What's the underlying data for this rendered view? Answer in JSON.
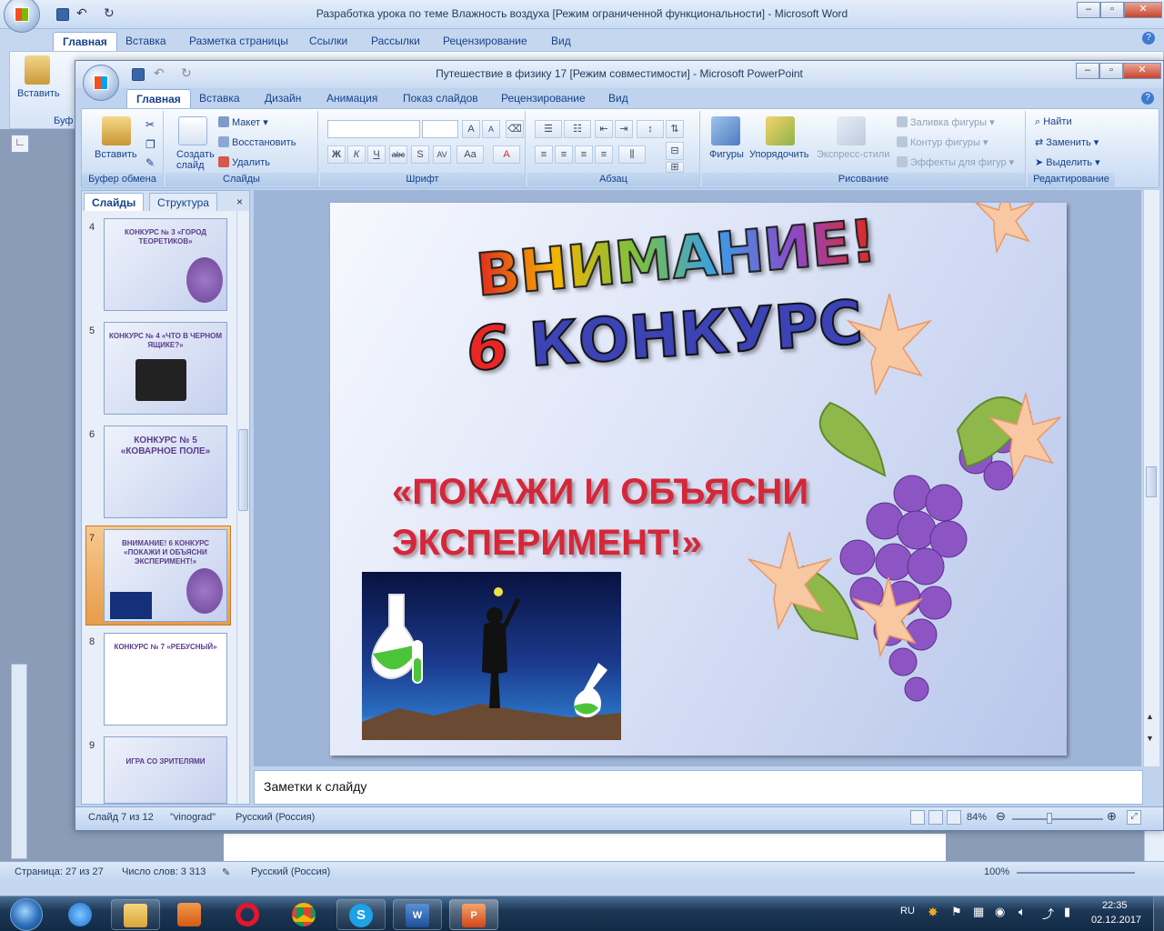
{
  "word": {
    "title": "Разработка урока по теме Влажность воздуха [Режим ограниченной функциональности] - Microsoft Word",
    "tabs": [
      "Главная",
      "Вставка",
      "Разметка страницы",
      "Ссылки",
      "Рассылки",
      "Рецензирование",
      "Вид"
    ],
    "paste_label": "Вставить",
    "clipboard_label": "Буф",
    "status": {
      "page": "Страница: 27 из 27",
      "words": "Число слов: 3 313",
      "lang": "Русский (Россия)",
      "zoom": "100%"
    }
  },
  "ppt": {
    "title": "Путешествие  в физику 17 [Режим совместимости] - Microsoft PowerPoint",
    "tabs": [
      "Главная",
      "Вставка",
      "Дизайн",
      "Анимация",
      "Показ слайдов",
      "Рецензирование",
      "Вид"
    ],
    "ribbon": {
      "clipboard": {
        "label": "Буфер обмена",
        "paste": "Вставить"
      },
      "slides": {
        "label": "Слайды",
        "new_slide": "Создать слайд",
        "layout": "Макет",
        "reset": "Восстановить",
        "delete": "Удалить"
      },
      "font": {
        "label": "Шрифт"
      },
      "paragraph": {
        "label": "Абзац"
      },
      "drawing": {
        "label": "Рисование",
        "shapes": "Фигуры",
        "arrange": "Упорядочить",
        "quick_styles": "Экспресс-стили",
        "fill": "Заливка фигуры",
        "outline": "Контур фигуры",
        "effects": "Эффекты для фигур"
      },
      "editing": {
        "label": "Редактирование",
        "find": "Найти",
        "replace": "Заменить",
        "select": "Выделить"
      }
    },
    "pane": {
      "tab_slides": "Слайды",
      "tab_outline": "Структура",
      "thumbs": [
        {
          "num": "4",
          "title": "КОНКУРС № 3 «ГОРОД ТЕОРЕТИКОВ»"
        },
        {
          "num": "5",
          "title": "КОНКУРС № 4 «ЧТО В ЧЕРНОМ ЯЩИКЕ?»"
        },
        {
          "num": "6",
          "title": "КОНКУРС № 5 «КОВАРНОЕ ПОЛЕ»"
        },
        {
          "num": "7",
          "title": "ВНИМАНИЕ! 6 КОНКУРС «ПОКАЖИ И ОБЪЯСНИ ЭКСПЕРИМЕНТ!»"
        },
        {
          "num": "8",
          "title": "КОНКУРС № 7 «РЕБУСНЫЙ»"
        },
        {
          "num": "9",
          "title": "ИГРА СО ЗРИТЕЛЯМИ"
        }
      ]
    },
    "slide": {
      "title_line1": "ВНИМАНИЕ!",
      "title_num": "6",
      "title_line2": "КОНКУРС",
      "subtitle_line1": "«ПОКАЖИ И ОБЪЯСНИ",
      "subtitle_line2": "ЭКСПЕРИМЕНТ!»"
    },
    "notes_placeholder": "Заметки к слайду",
    "status": {
      "slide": "Слайд 7 из 12",
      "theme": "\"vinograd\"",
      "lang": "Русский (Россия)",
      "zoom": "84%"
    }
  },
  "taskbar": {
    "lang": "RU",
    "time": "22:35",
    "date": "02.12.2017"
  },
  "colors": {
    "ribbon_blue": "#15428b",
    "slide_title_red": "#d6263a",
    "selection_orange": "#e89c4b"
  }
}
